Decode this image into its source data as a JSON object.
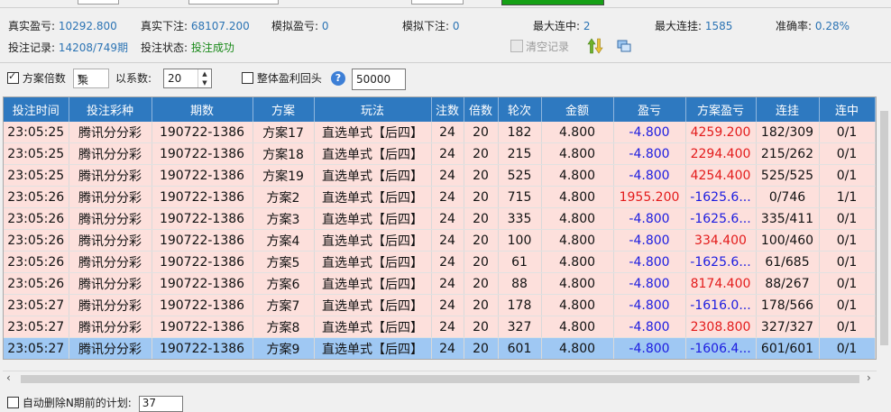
{
  "stats": {
    "real_profit_label": "真实盈亏:",
    "real_profit_value": "10292.800",
    "real_bet_label": "真实下注:",
    "real_bet_value": "68107.200",
    "sim_profit_label": "模拟盈亏:",
    "sim_profit_value": "0",
    "sim_bet_label": "模拟下注:",
    "sim_bet_value": "0",
    "max_win_streak_label": "最大连中:",
    "max_win_streak_value": "2",
    "max_loss_streak_label": "最大连挂:",
    "max_loss_streak_value": "1585",
    "accuracy_label": "准确率:",
    "accuracy_value": "0.28%",
    "bet_records_label": "投注记录:",
    "bet_records_value": "14208/749期",
    "bet_status_label": "投注状态:",
    "bet_status_value": "投注成功"
  },
  "toolbar": {
    "clear_label": "清空记录"
  },
  "options": {
    "multiplier_label": "方案倍数",
    "multiplier_checked": true,
    "operator_value": "乘",
    "coefficient_label": "以系数:",
    "coefficient_value": "20",
    "rollback_label": "整体盈利回头",
    "rollback_checked": false,
    "rollback_value": "50000"
  },
  "table": {
    "columns": [
      "投注时间",
      "投注彩种",
      "期数",
      "方案",
      "玩法",
      "注数",
      "倍数",
      "轮次",
      "金额",
      "盈亏",
      "方案盈亏",
      "连挂",
      "连中"
    ],
    "rows": [
      [
        "23:05:25",
        "腾讯分分彩",
        "190722-1386",
        "方案17",
        "直选单式【后四】",
        "24",
        "20",
        "182",
        "4.800",
        "-4.800",
        "4259.200",
        "182/309",
        "0/1"
      ],
      [
        "23:05:25",
        "腾讯分分彩",
        "190722-1386",
        "方案18",
        "直选单式【后四】",
        "24",
        "20",
        "215",
        "4.800",
        "-4.800",
        "2294.400",
        "215/262",
        "0/1"
      ],
      [
        "23:05:25",
        "腾讯分分彩",
        "190722-1386",
        "方案19",
        "直选单式【后四】",
        "24",
        "20",
        "525",
        "4.800",
        "-4.800",
        "4254.400",
        "525/525",
        "0/1"
      ],
      [
        "23:05:26",
        "腾讯分分彩",
        "190722-1386",
        "方案2",
        "直选单式【后四】",
        "24",
        "20",
        "715",
        "4.800",
        "1955.200",
        "-1625.6...",
        "0/746",
        "1/1"
      ],
      [
        "23:05:26",
        "腾讯分分彩",
        "190722-1386",
        "方案3",
        "直选单式【后四】",
        "24",
        "20",
        "335",
        "4.800",
        "-4.800",
        "-1625.6...",
        "335/411",
        "0/1"
      ],
      [
        "23:05:26",
        "腾讯分分彩",
        "190722-1386",
        "方案4",
        "直选单式【后四】",
        "24",
        "20",
        "100",
        "4.800",
        "-4.800",
        "334.400",
        "100/460",
        "0/1"
      ],
      [
        "23:05:26",
        "腾讯分分彩",
        "190722-1386",
        "方案5",
        "直选单式【后四】",
        "24",
        "20",
        "61",
        "4.800",
        "-4.800",
        "-1625.6...",
        "61/685",
        "0/1"
      ],
      [
        "23:05:26",
        "腾讯分分彩",
        "190722-1386",
        "方案6",
        "直选单式【后四】",
        "24",
        "20",
        "88",
        "4.800",
        "-4.800",
        "8174.400",
        "88/267",
        "0/1"
      ],
      [
        "23:05:27",
        "腾讯分分彩",
        "190722-1386",
        "方案7",
        "直选单式【后四】",
        "24",
        "20",
        "178",
        "4.800",
        "-4.800",
        "-1616.0...",
        "178/566",
        "0/1"
      ],
      [
        "23:05:27",
        "腾讯分分彩",
        "190722-1386",
        "方案8",
        "直选单式【后四】",
        "24",
        "20",
        "327",
        "4.800",
        "-4.800",
        "2308.800",
        "327/327",
        "0/1"
      ],
      [
        "23:05:27",
        "腾讯分分彩",
        "190722-1386",
        "方案9",
        "直选单式【后四】",
        "24",
        "20",
        "601",
        "4.800",
        "-4.800",
        "-1606.4...",
        "601/601",
        "0/1"
      ]
    ],
    "selected_row": 10
  },
  "bottom": {
    "auto_delete_label": "自动删除N期前的计划:",
    "auto_delete_value": "37"
  },
  "colors": {
    "header_bg": "#2e79c0",
    "row_bg": "#fde0dc",
    "selected_bg": "#9fc8f3",
    "negative": "#1c1ce0",
    "positive": "#e31b1b"
  }
}
